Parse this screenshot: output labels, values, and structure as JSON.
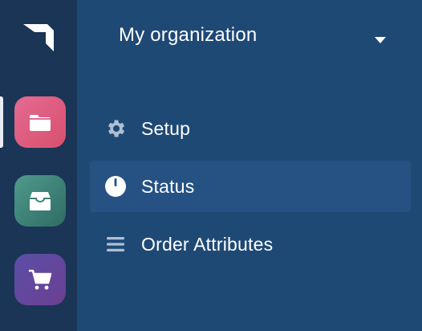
{
  "org_switcher": {
    "name": "My organization"
  },
  "rail": {
    "apps": [
      {
        "icon": "folder-icon",
        "color": "#dd5a7d"
      },
      {
        "icon": "archive-box-icon",
        "color": "#3f8378"
      },
      {
        "icon": "shopping-cart-icon",
        "color": "#623f9b"
      }
    ],
    "active_index": 0
  },
  "nav": {
    "items": [
      {
        "label": "Setup",
        "icon": "gear-icon",
        "active": false
      },
      {
        "label": "Status",
        "icon": "status-dial-icon",
        "active": true
      },
      {
        "label": "Order Attributes",
        "icon": "list-icon",
        "active": false
      }
    ]
  },
  "colors": {
    "rail_background": "#1a3555",
    "panel_background": "#1f4975",
    "active_item_background": "#255283",
    "icon_muted": "#aebfd4"
  }
}
